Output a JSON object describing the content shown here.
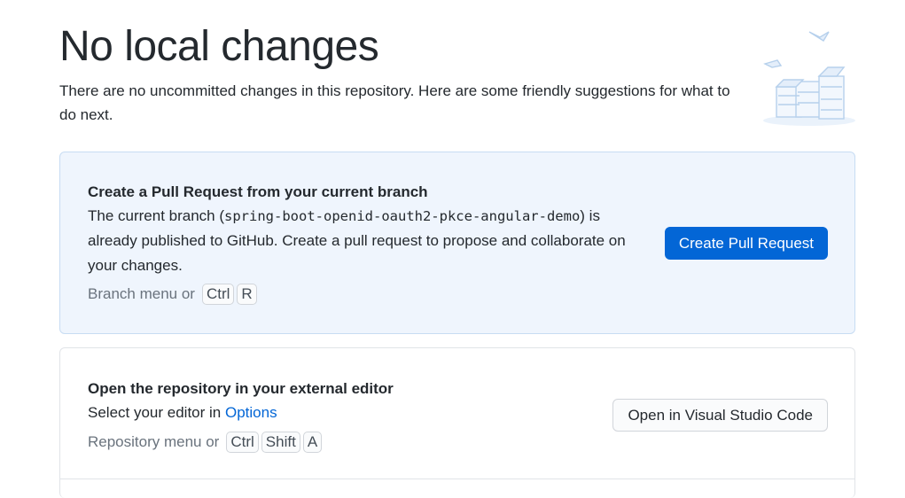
{
  "header": {
    "title": "No local changes",
    "subtitle": "There are no uncommitted changes in this repository. Here are some friendly suggestions for what to do next."
  },
  "pull_request_card": {
    "title": "Create a Pull Request from your current branch",
    "text_before": "The current branch (",
    "branch": "spring-boot-openid-oauth2-pkce-angular-demo",
    "text_after": ") is already published to GitHub. Create a pull request to propose and collaborate on your changes.",
    "shortcut_label": "Branch menu or",
    "shortcut_keys": [
      "Ctrl",
      "R"
    ],
    "button_label": "Create Pull Request"
  },
  "editor_card": {
    "title": "Open the repository in your external editor",
    "text_before": "Select your editor in",
    "options_link": "Options",
    "shortcut_label": "Repository menu or",
    "shortcut_keys": [
      "Ctrl",
      "Shift",
      "A"
    ],
    "button_label": "Open in Visual Studio Code"
  },
  "illustration": {
    "name": "empty-boxes-illustration",
    "accent": "#c8ddf3"
  },
  "colors": {
    "accent": "#0366d6",
    "card_primary_bg": "#eff5fd",
    "muted_text": "#6a737d"
  }
}
